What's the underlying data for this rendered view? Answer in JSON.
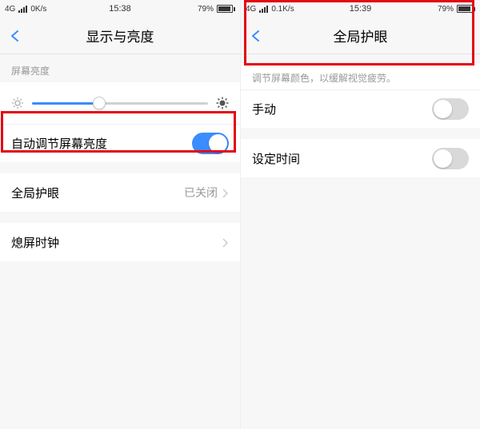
{
  "left": {
    "status": {
      "net": "4G",
      "speed": "0K/s",
      "time": "15:38",
      "battery": "79%"
    },
    "nav": {
      "title": "显示与亮度"
    },
    "brightness_section_label": "屏幕亮度",
    "auto_brightness_label": "自动调节屏幕亮度",
    "eye_care_label": "全局护眼",
    "eye_care_value": "已关闭",
    "lock_clock_label": "熄屏时钟"
  },
  "right": {
    "status": {
      "net": "4G",
      "speed": "0.1K/s",
      "time": "15:39",
      "battery": "79%"
    },
    "nav": {
      "title": "全局护眼"
    },
    "hint": "调节屏幕颜色，以缓解视觉疲劳。",
    "manual_label": "手动",
    "schedule_label": "设定时间"
  }
}
